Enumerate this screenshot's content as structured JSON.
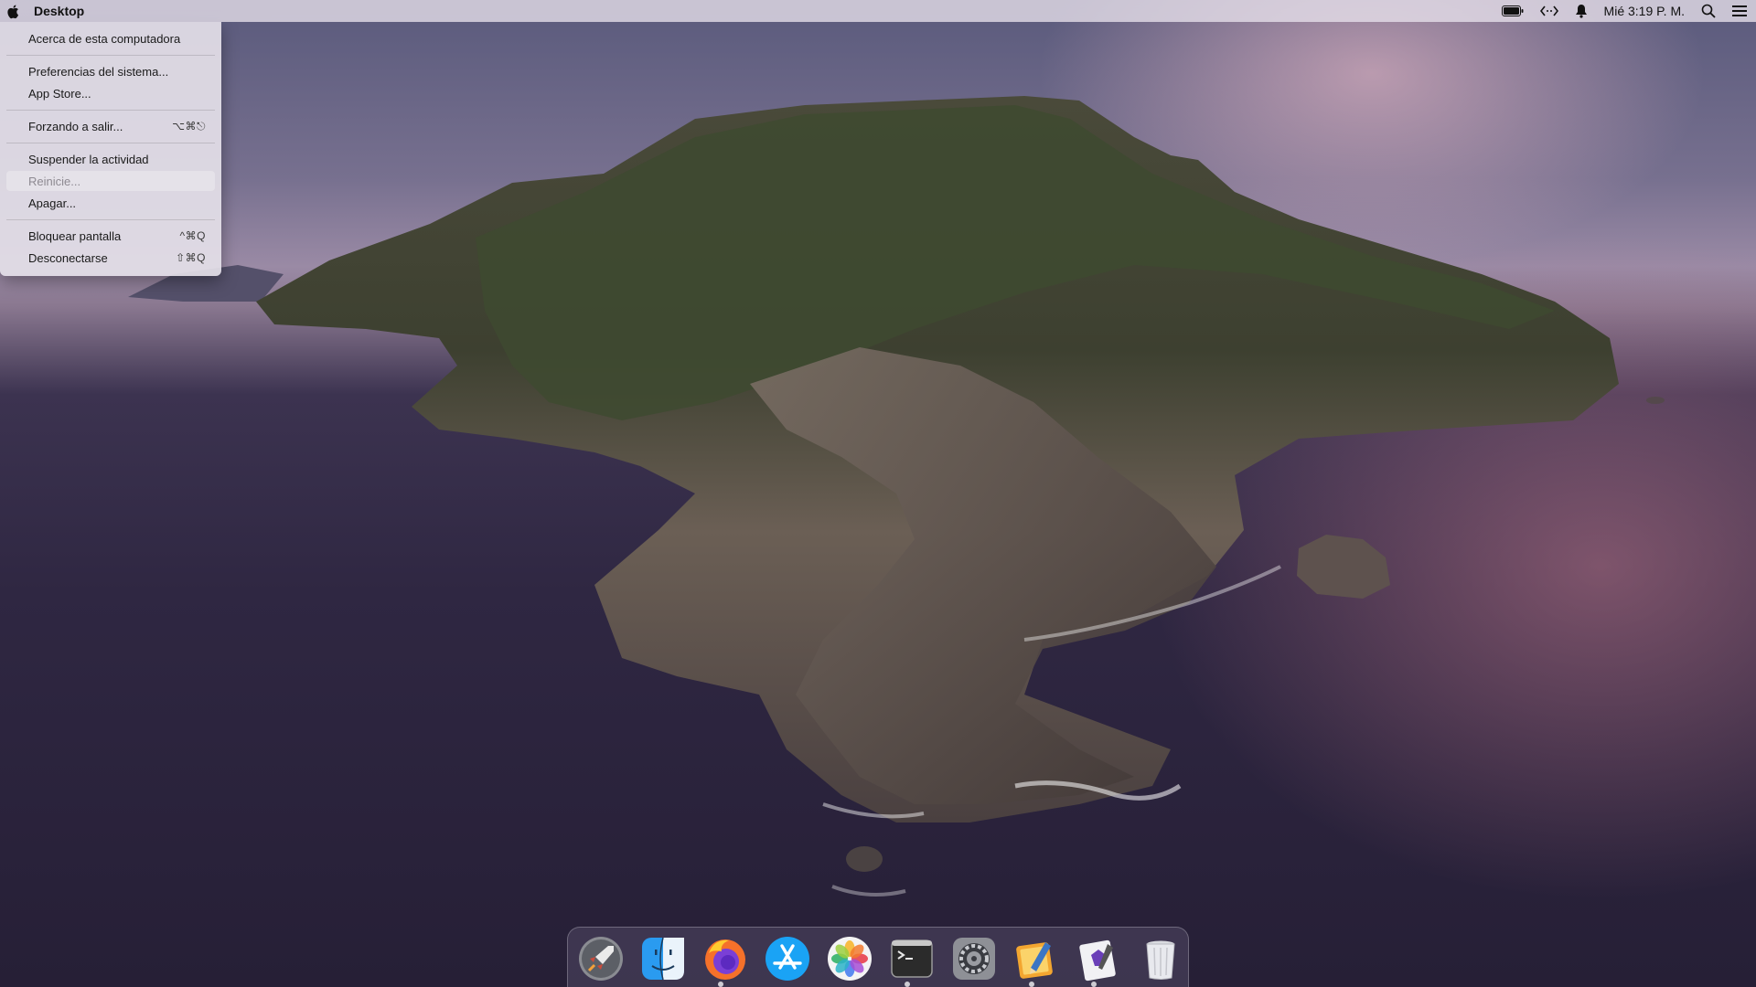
{
  "menubar": {
    "app_name": "Desktop",
    "clock": "Mié 3:19 P. M.",
    "icons": [
      "apple-icon",
      "battery-icon",
      "arrows-icon",
      "notification-bell-icon",
      "spotlight-search-icon",
      "control-center-icon"
    ]
  },
  "apple_menu": {
    "items": [
      {
        "label": "Acerca de esta computadora",
        "shortcut": ""
      },
      {
        "label": "Preferencias del sistema...",
        "shortcut": ""
      },
      {
        "label": "App Store...",
        "shortcut": ""
      },
      {
        "label": "Forzando a salir...",
        "shortcut": "⌥⌘⎋"
      },
      {
        "label": "Suspender la actividad",
        "shortcut": ""
      },
      {
        "label": "Reinicie...",
        "shortcut": "",
        "disabled": true
      },
      {
        "label": "Apagar...",
        "shortcut": ""
      },
      {
        "label": "Bloquear pantalla",
        "shortcut": "^⌘Q"
      },
      {
        "label": "Desconectarse",
        "shortcut": "⇧⌘Q"
      }
    ]
  },
  "dock": {
    "apps": [
      {
        "icon": "launchpad-rocket-icon",
        "running": false
      },
      {
        "icon": "finder-icon",
        "running": false
      },
      {
        "icon": "firefox-icon",
        "running": true
      },
      {
        "icon": "app-store-icon",
        "running": false
      },
      {
        "icon": "photos-icon",
        "running": false
      },
      {
        "icon": "terminal-icon",
        "running": true
      },
      {
        "icon": "system-preferences-gear-icon",
        "running": false
      },
      {
        "icon": "notes-pencil-icon",
        "running": true
      },
      {
        "icon": "script-editor-icon",
        "running": true
      },
      {
        "icon": "trash-icon",
        "running": false
      }
    ]
  },
  "colors": {
    "menubar_bg": "#e8e2ec",
    "menu_bg": "#e4e0e8",
    "dock_bg": "#5a526e"
  }
}
